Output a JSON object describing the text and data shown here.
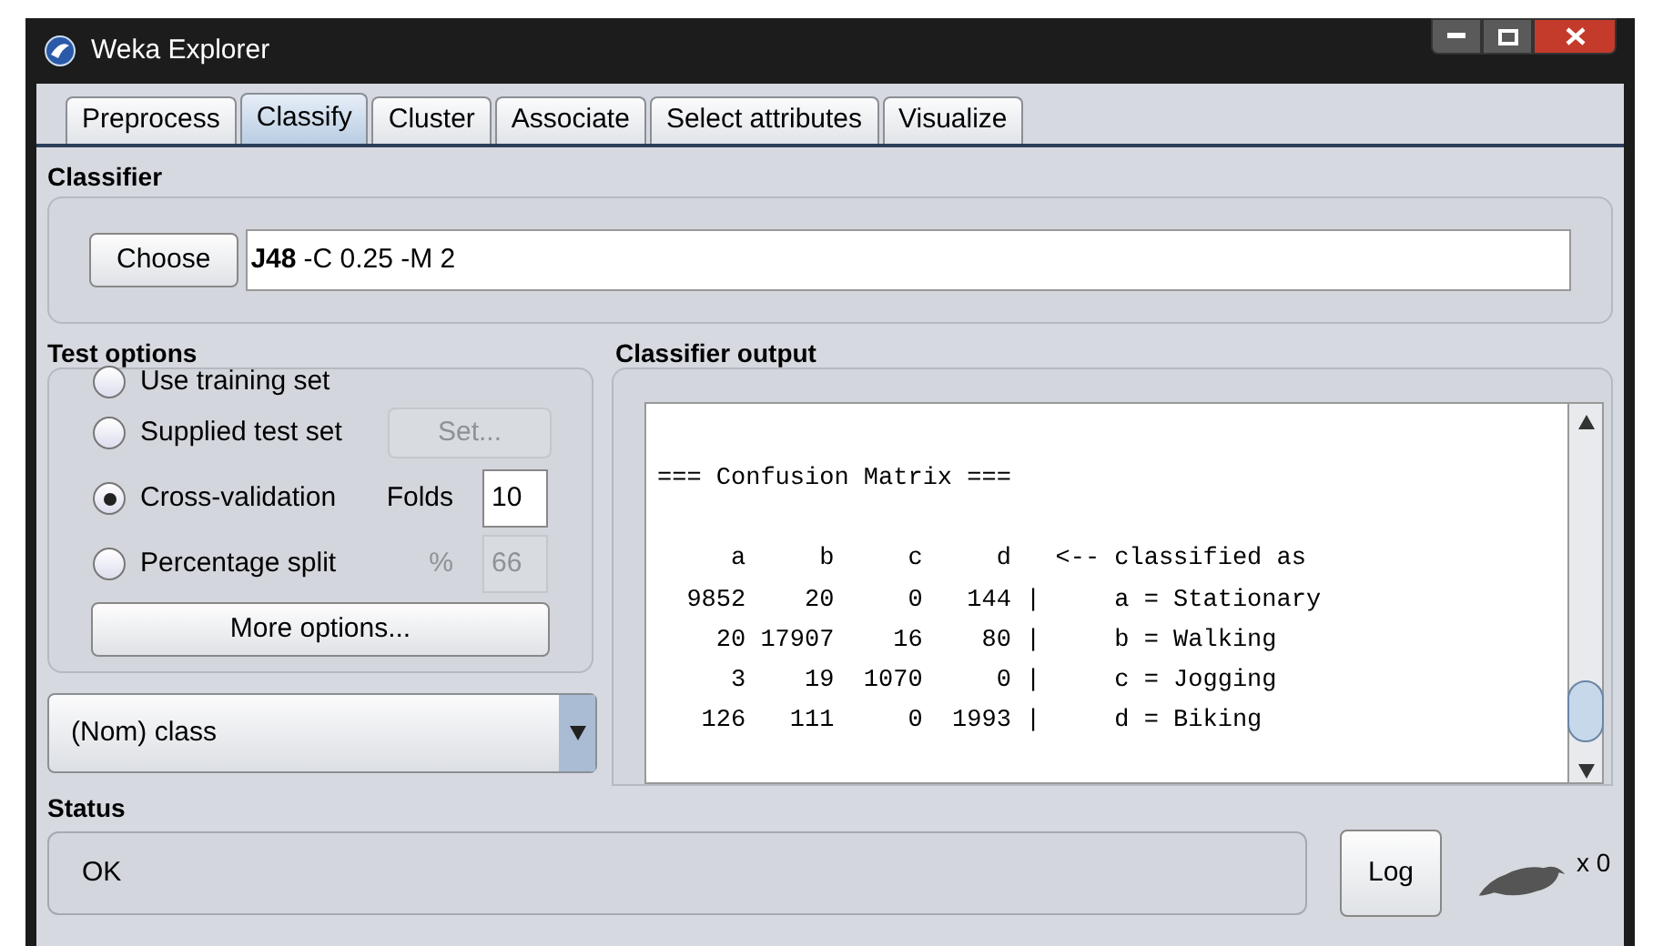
{
  "window": {
    "title": "Weka Explorer"
  },
  "tabs": [
    {
      "label": "Preprocess",
      "selected": false
    },
    {
      "label": "Classify",
      "selected": true
    },
    {
      "label": "Cluster",
      "selected": false
    },
    {
      "label": "Associate",
      "selected": false
    },
    {
      "label": "Select attributes",
      "selected": false
    },
    {
      "label": "Visualize",
      "selected": false
    }
  ],
  "classifier": {
    "heading": "Classifier",
    "button": "Choose",
    "name": "J48",
    "options": "-C 0.25 -M 2"
  },
  "test_options": {
    "heading": "Test options",
    "options": [
      {
        "label": "Use training set",
        "selected": false,
        "kind": "plain"
      },
      {
        "label": "Supplied test set",
        "selected": false,
        "kind": "button",
        "button": "Set...",
        "disabled": true
      },
      {
        "label": "Cross-validation",
        "selected": true,
        "kind": "field",
        "field_label": "Folds",
        "value": "10",
        "disabled": false
      },
      {
        "label": "Percentage split",
        "selected": false,
        "kind": "field",
        "field_label": "%",
        "value": "66",
        "disabled": true
      }
    ],
    "more_button": "More options..."
  },
  "class_dropdown": {
    "value": "(Nom) class"
  },
  "output": {
    "heading": "Classifier output",
    "lines": [
      "=== Confusion Matrix ===",
      "     a     b     c     d   <-- classified as",
      "  9852    20     0   144 |     a = Stationary",
      "    20 17907    16    80 |     b = Walking",
      "     3    19  1070     0 |     c = Jogging",
      "   126   111     0  1993 |     d = Biking"
    ]
  },
  "status": {
    "heading": "Status",
    "text": "OK",
    "log_button": "Log",
    "count": "x 0"
  }
}
